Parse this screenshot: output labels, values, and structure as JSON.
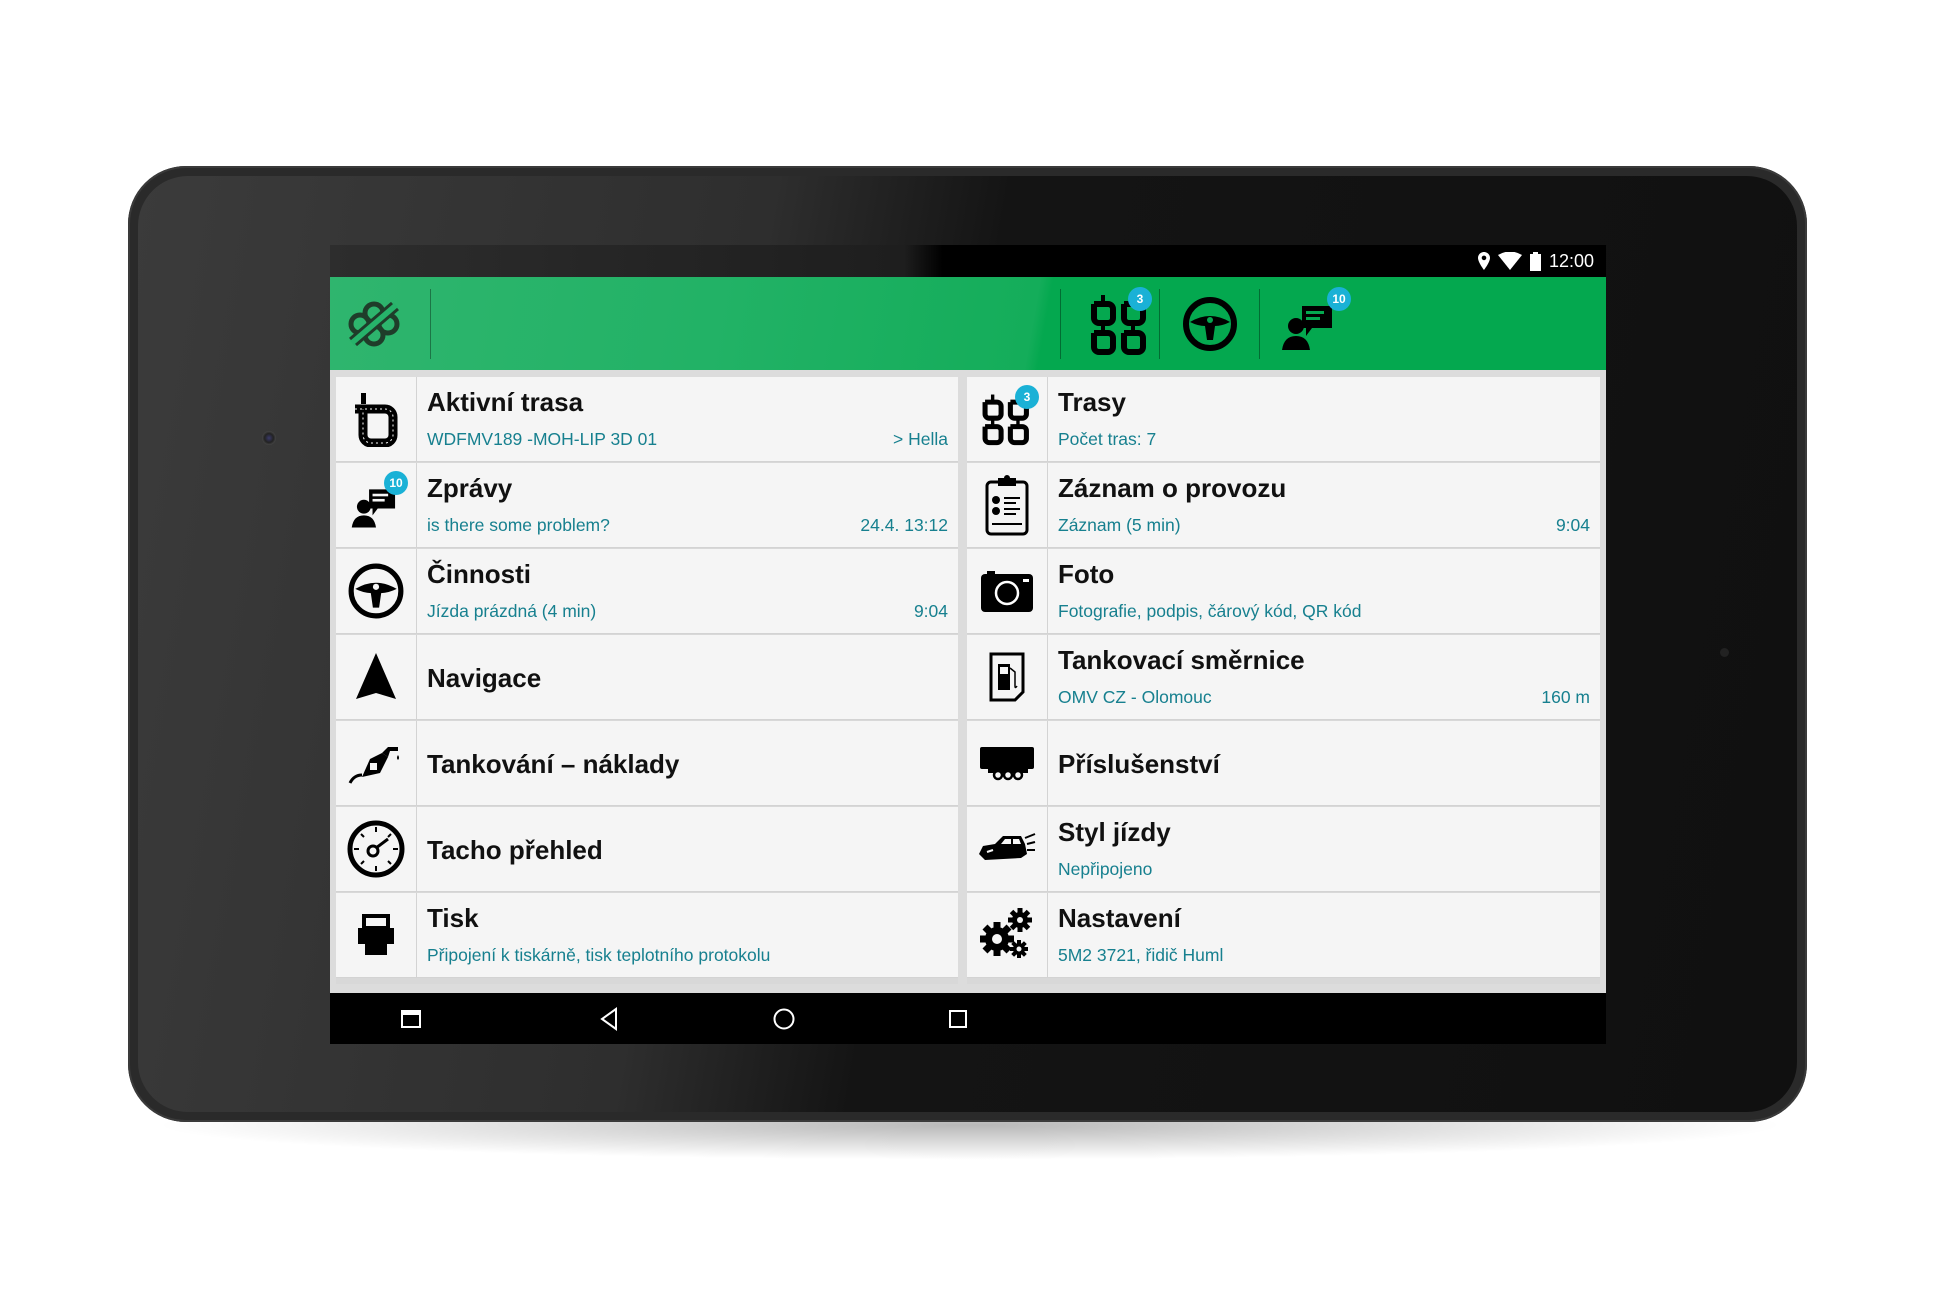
{
  "status_bar": {
    "time": "12:00",
    "icons": [
      "location-icon",
      "wifi-icon",
      "battery-icon"
    ]
  },
  "app_bar": {
    "logo": "app-logo-icon",
    "actions": [
      {
        "name": "routes",
        "icon": "routes-icon",
        "badge": "3"
      },
      {
        "name": "activities",
        "icon": "steering-wheel-icon",
        "badge": ""
      },
      {
        "name": "messages",
        "icon": "messages-icon",
        "badge": "10"
      }
    ]
  },
  "colors": {
    "accent_green": "#04a84f",
    "badge_blue": "#1ab1d6",
    "subtitle_teal": "#17808f",
    "row_bg": "#f5f5f5"
  },
  "menu": {
    "left": [
      {
        "title": "Aktivní trasa",
        "subtitle": "WDFMV189 -MOH-LIP 3D 01",
        "meta": "> Hella",
        "icon": "active-route-icon",
        "badge": ""
      },
      {
        "title": "Zprávy",
        "subtitle": "is there some problem?",
        "meta": "24.4. 13:12",
        "icon": "messages-icon",
        "badge": "10"
      },
      {
        "title": "Činnosti",
        "subtitle": "Jízda prázdná (4 min)",
        "meta": "9:04",
        "icon": "steering-wheel-icon",
        "badge": ""
      },
      {
        "title": "Navigace",
        "subtitle": "",
        "meta": "",
        "icon": "navigation-arrow-icon",
        "badge": ""
      },
      {
        "title": "Tankování – náklady",
        "subtitle": "",
        "meta": "",
        "icon": "fuel-nozzle-icon",
        "badge": ""
      },
      {
        "title": "Tacho přehled",
        "subtitle": "",
        "meta": "",
        "icon": "tachograph-icon",
        "badge": ""
      },
      {
        "title": "Tisk",
        "subtitle": "Připojení k tiskárně, tisk teplotního protokolu",
        "meta": "",
        "icon": "printer-icon",
        "badge": ""
      }
    ],
    "right": [
      {
        "title": "Trasy",
        "subtitle": "Počet tras: 7",
        "meta": "",
        "icon": "routes-icon",
        "badge": "3"
      },
      {
        "title": "Záznam o provozu",
        "subtitle": "Záznam (5 min)",
        "meta": "9:04",
        "icon": "clipboard-checklist-icon",
        "badge": ""
      },
      {
        "title": "Foto",
        "subtitle": "Fotografie, podpis, čárový kód, QR kód",
        "meta": "",
        "icon": "camera-icon",
        "badge": ""
      },
      {
        "title": "Tankovací směrnice",
        "subtitle": "OMV CZ - Olomouc",
        "meta": "160 m",
        "icon": "fuel-station-document-icon",
        "badge": ""
      },
      {
        "title": "Příslušenství",
        "subtitle": "",
        "meta": "",
        "icon": "trailer-icon",
        "badge": ""
      },
      {
        "title": "Styl jízdy",
        "subtitle": "Nepřipojeno",
        "meta": "",
        "icon": "car-speed-icon",
        "badge": ""
      },
      {
        "title": "Nastavení",
        "subtitle": "5M2 3721, řidič Huml",
        "meta": "",
        "icon": "gears-icon",
        "badge": ""
      }
    ]
  },
  "nav_bar": {
    "buttons": [
      "menu-window-icon",
      "back-icon",
      "home-icon",
      "recents-icon"
    ]
  }
}
